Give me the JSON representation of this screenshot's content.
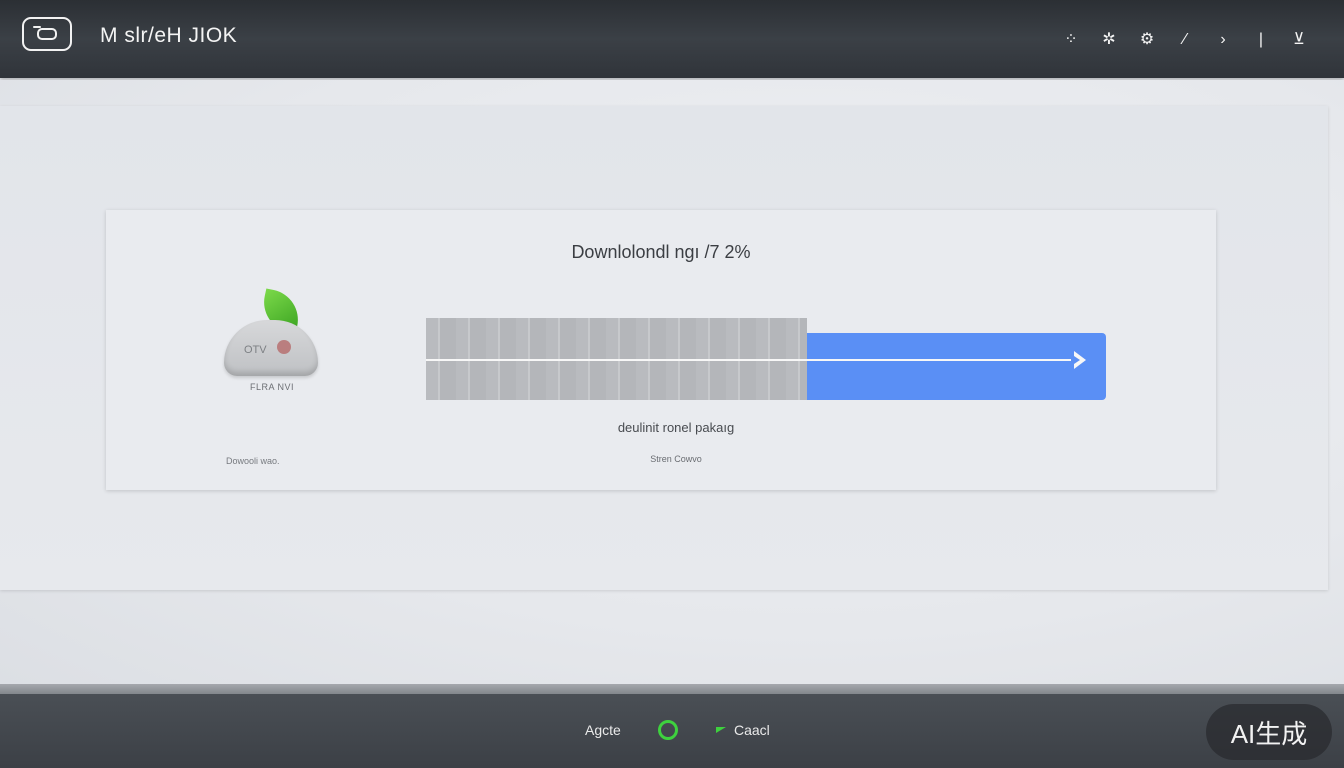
{
  "header": {
    "title": "M slr/eH JIOK",
    "toolbar": [
      {
        "name": "nodes-icon",
        "glyph": "⁘"
      },
      {
        "name": "gear-icon",
        "glyph": "✲"
      },
      {
        "name": "settings-icon",
        "glyph": "⚙"
      },
      {
        "name": "edit-icon",
        "glyph": "⁄"
      },
      {
        "name": "chevron-right-icon",
        "glyph": "›"
      },
      {
        "name": "divider-icon",
        "glyph": "|"
      },
      {
        "name": "download-icon",
        "glyph": "⊻"
      }
    ]
  },
  "dialog": {
    "title": "Downlolondl ngı /7 2%",
    "package": {
      "label": "OTV",
      "caption": "FLRA NVI",
      "footnote": "Dowooli wao."
    },
    "progress": {
      "value": 0.56,
      "fill_color": "#5a8ff5"
    },
    "status": "deulinit ronel pakaıg",
    "sub_status": "Stren Cowvo"
  },
  "footer": {
    "apply_label": "Agcte",
    "cancel_label": "Caacl",
    "status_color": "#3ed13e"
  },
  "watermark": {
    "text": "AI生成"
  }
}
